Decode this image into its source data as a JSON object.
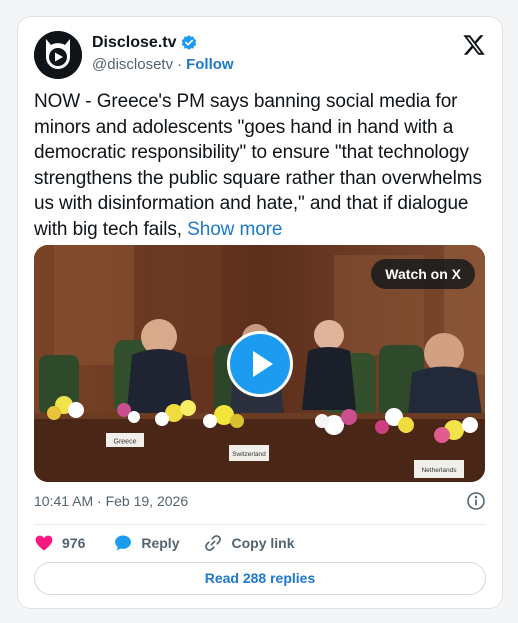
{
  "author": {
    "display_name": "Disclose.tv",
    "handle": "@disclosetv",
    "separator": "·",
    "follow_label": "Follow"
  },
  "tweet": {
    "text": "NOW - Greece's PM says banning social media for minors and adolescents \"goes hand in hand with a democratic responsibility\" to ensure \"that technology strengthens the public square rather than overwhelms us with disinformation and hate,\" and that if dialogue with big tech fails,",
    "show_more_label": "Show more",
    "timestamp": "10:41 AM · Feb 19, 2026"
  },
  "media": {
    "watch_label": "Watch on X",
    "nameplates": [
      "Greece",
      "Switzerland",
      "Netherlands"
    ]
  },
  "actions": {
    "like_count": "976",
    "reply_label": "Reply",
    "copy_link_label": "Copy link"
  },
  "read_replies_label": "Read 288 replies",
  "colors": {
    "accent": "#1d9bf0",
    "link": "#1d79c9",
    "like": "#f91880",
    "text": "#0f1419",
    "muted": "#536471"
  },
  "icons": {
    "x_logo": "x-logo-icon",
    "verified": "verified-badge-icon",
    "info": "info-icon",
    "like": "heart-icon",
    "reply": "speech-bubble-icon",
    "copy_link": "link-icon",
    "play": "play-icon"
  }
}
